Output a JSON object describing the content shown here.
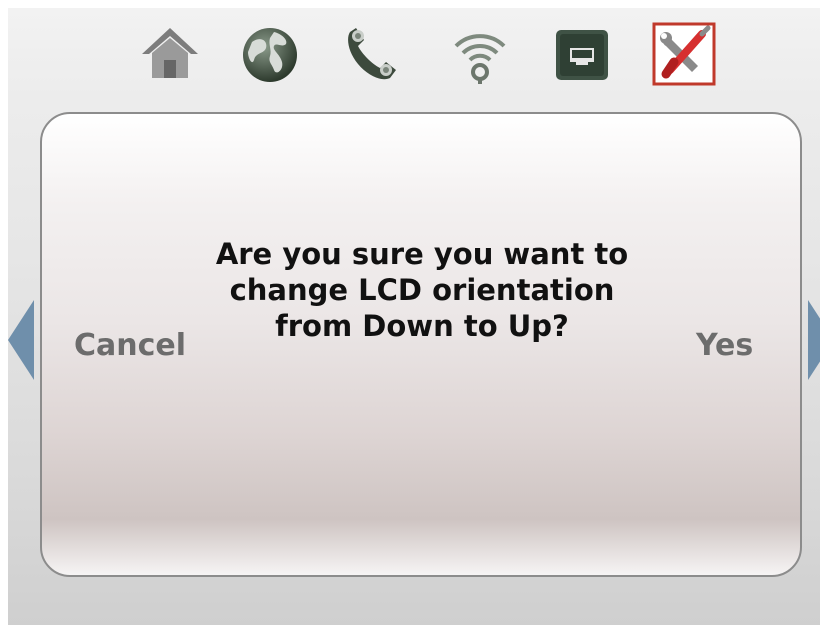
{
  "toolbar": {
    "icons": [
      "home-icon",
      "internet-globe-icon",
      "phone-icon",
      "wifi-icon",
      "ethernet-port-icon",
      "tools-settings-icon"
    ],
    "selected": "tools-settings-icon"
  },
  "dialog": {
    "message": "Are you sure you want to change LCD orientation from Down to Up?",
    "cancel_label": "Cancel",
    "confirm_label": "Yes"
  },
  "colors": {
    "accent_arrow": "#6f8fab",
    "selected_border": "#c0392b",
    "button_text": "#6c6c6c"
  }
}
